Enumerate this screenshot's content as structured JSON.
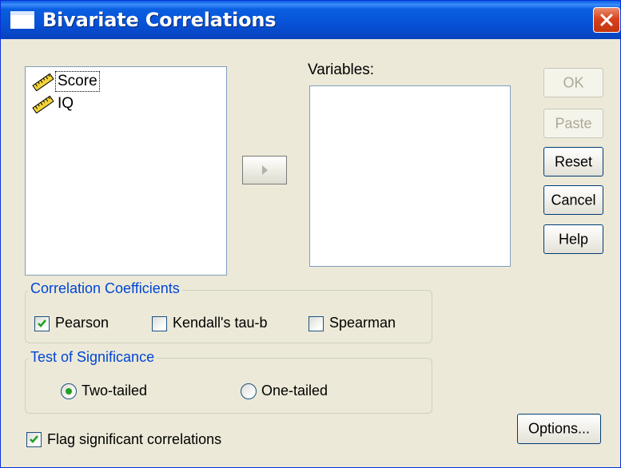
{
  "window": {
    "title": "Bivariate Correlations",
    "close_icon": "close-icon"
  },
  "source_list": {
    "items": [
      {
        "label": "Score",
        "icon": "scale-variable-icon"
      },
      {
        "label": "IQ",
        "icon": "scale-variable-icon"
      }
    ]
  },
  "move_button": {
    "icon": "right-arrow-icon"
  },
  "variables": {
    "label": "Variables:",
    "items": []
  },
  "buttons": {
    "ok": "OK",
    "paste": "Paste",
    "reset": "Reset",
    "cancel": "Cancel",
    "help": "Help",
    "options": "Options..."
  },
  "correlation_coefficients": {
    "legend": "Correlation Coefficients",
    "pearson": {
      "label": "Pearson",
      "checked": true
    },
    "kendall": {
      "label": "Kendall's tau-b",
      "checked": false
    },
    "spearman": {
      "label": "Spearman",
      "checked": false
    }
  },
  "test_of_significance": {
    "legend": "Test of Significance",
    "two_tailed": {
      "label": "Two-tailed",
      "selected": true
    },
    "one_tailed": {
      "label": "One-tailed",
      "selected": false
    }
  },
  "flag_significant": {
    "label": "Flag significant correlations",
    "checked": true
  },
  "colors": {
    "title_bar": "#0a5ee0",
    "group_legend": "#0046d5",
    "dialog_bg": "#ece9d8",
    "radio_dot": "#21a121"
  }
}
